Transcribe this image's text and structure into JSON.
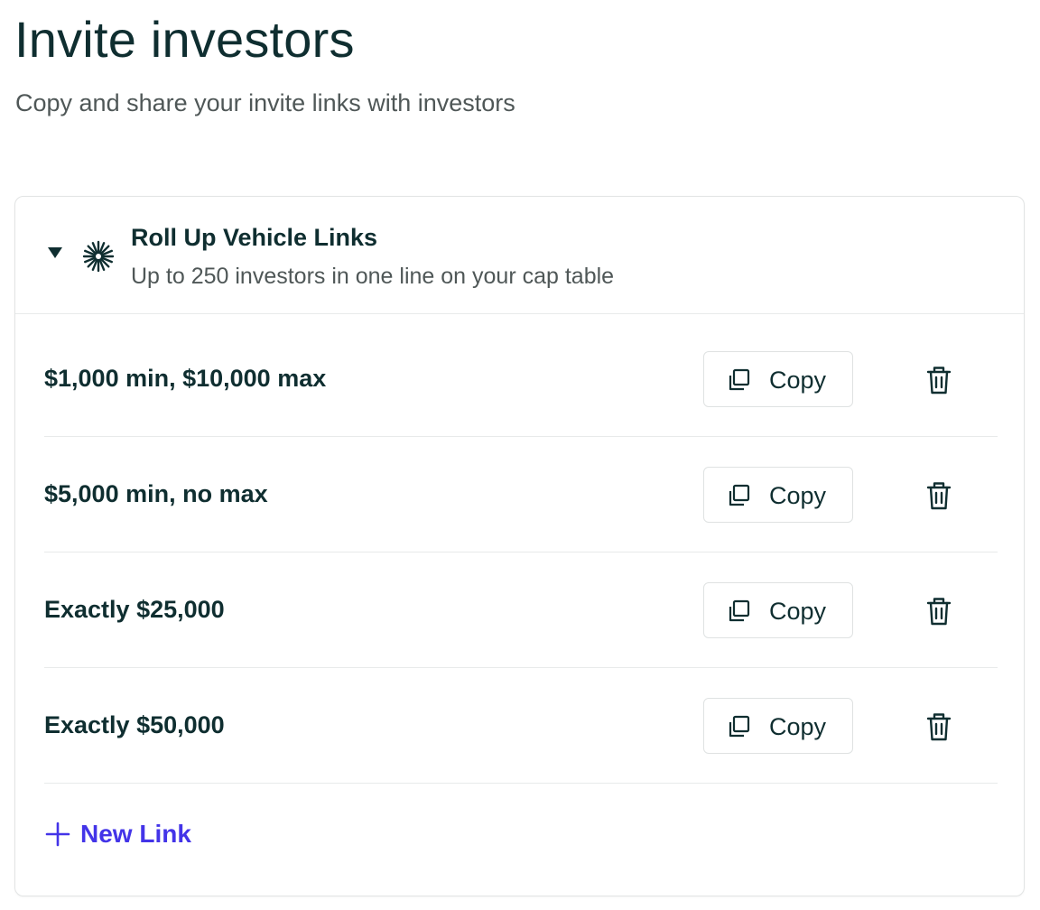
{
  "page": {
    "title": "Invite investors",
    "subtitle": "Copy and share your invite links with investors"
  },
  "group": {
    "title": "Roll Up Vehicle Links",
    "description": "Up to 250 investors in one line on your cap table",
    "icons": {
      "toggle": "caret-down-icon",
      "group": "starburst-icon"
    }
  },
  "links": [
    {
      "label": "$1,000 min, $10,000 max",
      "copy_label": "Copy"
    },
    {
      "label": "$5,000 min, no max",
      "copy_label": "Copy"
    },
    {
      "label": "Exactly $25,000",
      "copy_label": "Copy"
    },
    {
      "label": "Exactly $50,000",
      "copy_label": "Copy"
    }
  ],
  "actions": {
    "new_link_label": "New Link"
  },
  "colors": {
    "text_primary": "#0f2e30",
    "text_secondary": "#4f5757",
    "accent": "#4334e8",
    "border": "#e2e4e4"
  }
}
